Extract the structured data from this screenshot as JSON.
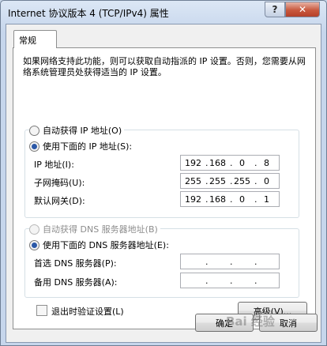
{
  "window": {
    "title": "Internet 协议版本 4 (TCP/IPv4) 属性",
    "help_label": "?",
    "close_label": "✕"
  },
  "tabs": [
    {
      "label": "常规"
    }
  ],
  "description": "如果网络支持此功能，则可以获取自动指派的 IP 设置。否则，您需要从网络系统管理员处获得适当的 IP 设置。",
  "ip_section": {
    "auto_label": "自动获得 IP 地址(O)",
    "manual_label": "使用下面的 IP 地址(S):",
    "selected": "manual",
    "fields": [
      {
        "label": "IP 地址(I):",
        "octets": [
          "192",
          "168",
          "0",
          "8"
        ]
      },
      {
        "label": "子网掩码(U):",
        "octets": [
          "255",
          "255",
          "255",
          "0"
        ]
      },
      {
        "label": "默认网关(D):",
        "octets": [
          "192",
          "168",
          "0",
          "1"
        ]
      }
    ]
  },
  "dns_section": {
    "auto_label": "自动获得 DNS 服务器地址(B)",
    "manual_label": "使用下面的 DNS 服务器地址(E):",
    "selected": "manual",
    "fields": [
      {
        "label": "首选 DNS 服务器(P):",
        "octets": [
          "",
          "",
          "",
          ""
        ]
      },
      {
        "label": "备用 DNS 服务器(A):",
        "octets": [
          "",
          "",
          "",
          ""
        ]
      }
    ]
  },
  "validate_label": "退出时验证设置(L)",
  "validate_checked": false,
  "advanced_label": "高级(V)...",
  "ok_label": "确定",
  "cancel_label": "取消",
  "watermark_text": "Bai 经验"
}
